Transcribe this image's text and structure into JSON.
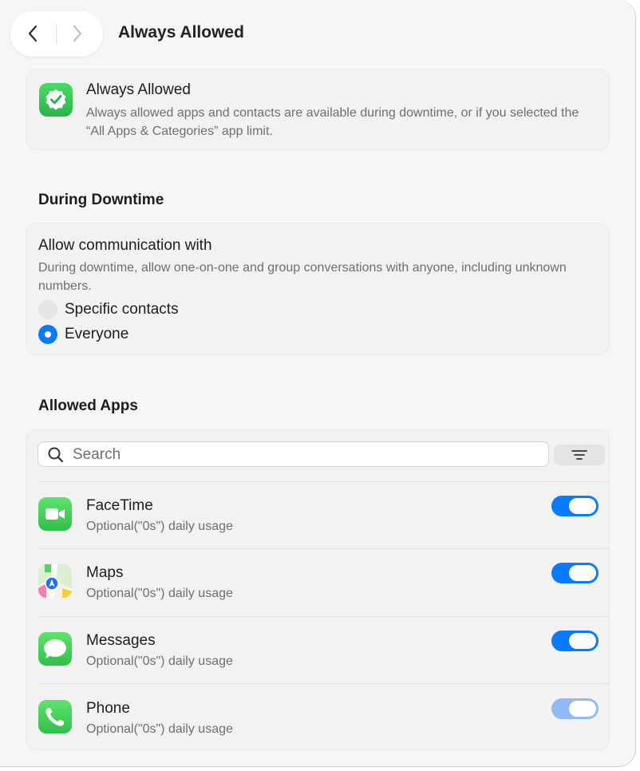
{
  "header": {
    "title": "Always Allowed",
    "back_icon": "chevron-left-icon",
    "forward_icon": "chevron-right-icon"
  },
  "info_card": {
    "icon": "checkmark-seal-icon",
    "title": "Always Allowed",
    "description": "Always allowed apps and contacts are available during downtime, or if you selected the “All Apps & Categories” app limit."
  },
  "downtime": {
    "section_title": "During Downtime",
    "title": "Allow communication with",
    "description": "During downtime, allow one-on-one and group conversations with anyone, including unknown numbers.",
    "options": [
      {
        "label": "Specific contacts",
        "selected": false
      },
      {
        "label": "Everyone",
        "selected": true
      }
    ]
  },
  "allowed_apps": {
    "section_title": "Allowed Apps",
    "search_placeholder": "Search",
    "filter_icon": "filter-icon",
    "apps": [
      {
        "name": "FaceTime",
        "subtitle": "Optional(\"0s\") daily usage",
        "icon": "facetime-icon",
        "enabled": true
      },
      {
        "name": "Maps",
        "subtitle": "Optional(\"0s\") daily usage",
        "icon": "maps-icon",
        "enabled": true
      },
      {
        "name": "Messages",
        "subtitle": "Optional(\"0s\") daily usage",
        "icon": "messages-icon",
        "enabled": true
      },
      {
        "name": "Phone",
        "subtitle": "Optional(\"0s\") daily usage",
        "icon": "phone-icon",
        "enabled": true,
        "dimmed": true
      }
    ]
  },
  "colors": {
    "accent": "#0a7aff",
    "green_icon": "#34c759"
  }
}
